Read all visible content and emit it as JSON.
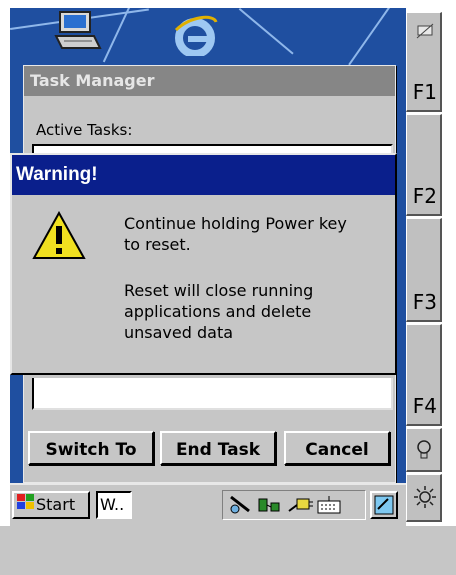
{
  "task_manager": {
    "title": "Task Manager",
    "active_tasks_label": "Active Tasks:",
    "buttons": {
      "switch_to": "Switch To",
      "end_task": "End Task",
      "cancel": "Cancel"
    }
  },
  "warning": {
    "title": "Warning!",
    "line1": "Continue holding Power key",
    "line2": "to reset.",
    "line3": "Reset will close running",
    "line4": "applications and delete",
    "line5": "unsaved data"
  },
  "taskbar": {
    "start_label": "Start",
    "task_label": "W.."
  },
  "function_keys": [
    "F1",
    "F2",
    "F3",
    "F4"
  ],
  "colors": {
    "desktop": "#1f4fa0",
    "warning_title_bar": "#0a1f8c",
    "dialog_face": "#c6c6c6"
  }
}
